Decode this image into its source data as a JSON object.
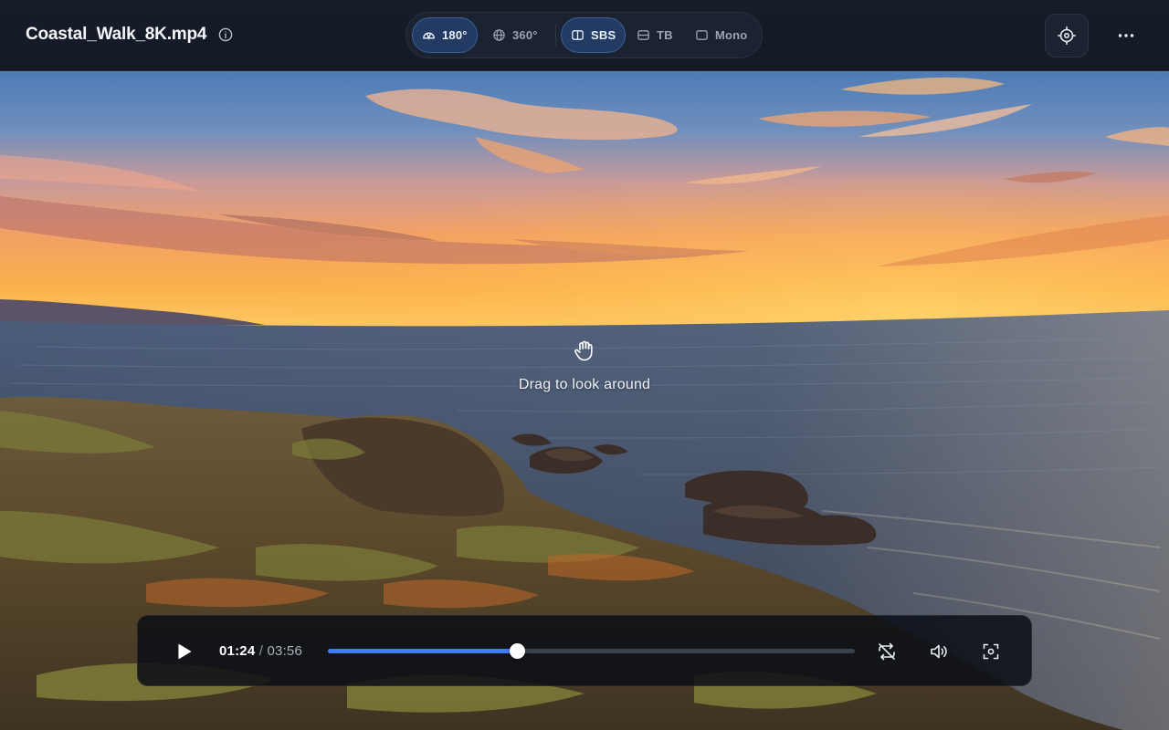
{
  "file": {
    "title": "Coastal_Walk_8K.mp4",
    "info_icon": "info-circle-icon"
  },
  "modes": [
    {
      "label": "180°",
      "icon": "half-dome-icon",
      "active": true
    },
    {
      "label": "360°",
      "icon": "globe-icon",
      "active": false
    },
    {
      "label": "SBS",
      "icon": "side-by-side-icon",
      "active": true
    },
    {
      "label": "TB",
      "icon": "top-bottom-icon",
      "active": false
    },
    {
      "label": "Mono",
      "icon": "mono-square-icon",
      "active": false
    }
  ],
  "header_actions": {
    "recenter_icon": "crosshair-icon",
    "more_icon": "more-horizontal-icon"
  },
  "hint": {
    "text": "Drag to look around",
    "icon": "hand-grab-icon"
  },
  "player": {
    "current": "01:24",
    "separator": " / ",
    "duration": "03:56",
    "progress": 0.359,
    "play_icon": "play-icon",
    "loop_off_icon": "repeat-off-icon",
    "volume_icon": "volume-icon",
    "recenter_icon": "focus-frame-icon"
  },
  "colors": {
    "accent": "#3f7df2",
    "active_segment": "#233a63",
    "topbar": "#161c28"
  }
}
